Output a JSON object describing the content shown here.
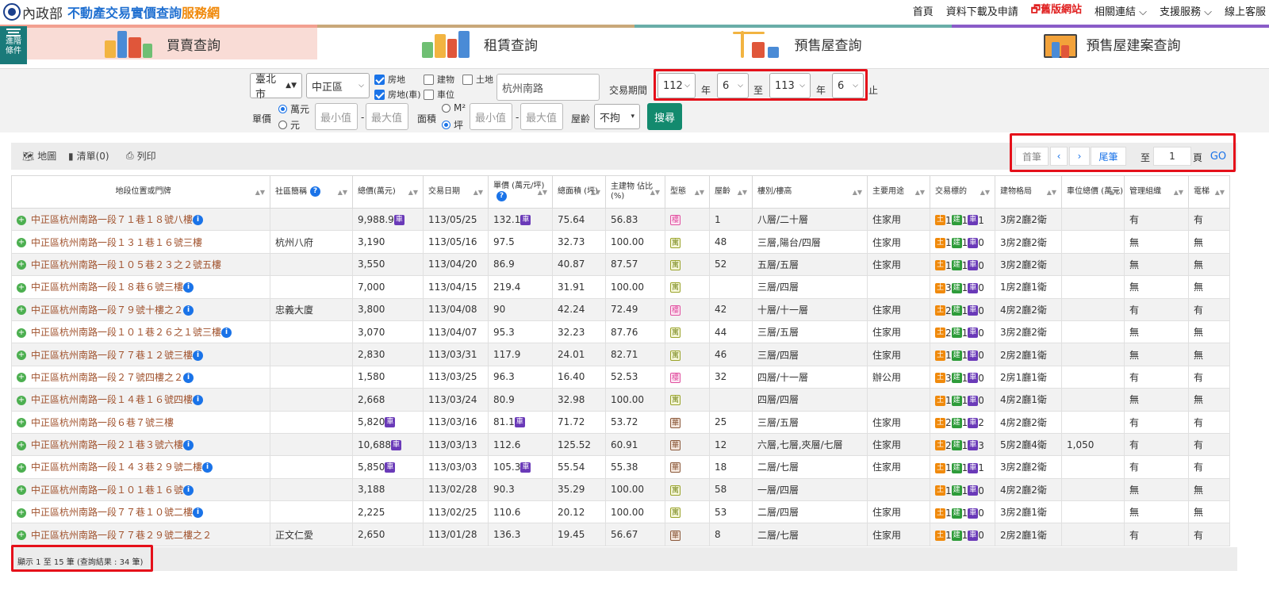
{
  "header": {
    "ministry": "內政部",
    "title_blue": "不動產交易實價查詢",
    "title_orange": "服務網",
    "nav": [
      {
        "label": "首頁"
      },
      {
        "label": "資料下載及申請"
      },
      {
        "label": "🗗舊版網站"
      },
      {
        "label": "相關連結 ⌵"
      },
      {
        "label": "支援服務 ⌵"
      },
      {
        "label": "線上客服"
      }
    ]
  },
  "advanced": {
    "label1": "進階",
    "label2": "條件"
  },
  "tabs": [
    {
      "label": "買賣查詢",
      "color": "#f2a090"
    },
    {
      "label": "租賃查詢",
      "color": "#c9a87a"
    },
    {
      "label": "預售屋查詢",
      "color": "#6aaea8"
    },
    {
      "label": "預售屋建案查詢",
      "color": "#8a5cc8"
    }
  ],
  "filters": {
    "city": "臺北市",
    "district": "中正區",
    "cb_land": "房地",
    "cb_land_car": "房地(車)",
    "cb_building": "建物",
    "cb_parking": "車位",
    "cb_soil": "土地",
    "road": "杭州南路",
    "period_label": "交易期間",
    "year_from": "112",
    "month_from": "6",
    "year_to": "113",
    "month_to": "6",
    "year_unit": "年",
    "to": "至",
    "end": "止",
    "price_label": "單價",
    "unit_wan": "萬元",
    "unit_yuan": "元",
    "min": "最小值",
    "max": "最大值",
    "dash": "-",
    "area_label": "面積",
    "unit_m2": "M²",
    "unit_ping": "坪",
    "age_label": "屋齡",
    "age_value": "不拘",
    "search": "搜尋"
  },
  "toolbar": {
    "map": "地圖",
    "list": "清單(0)",
    "print": "列印"
  },
  "pager": {
    "first": "首筆",
    "prev": "‹",
    "next": "›",
    "last": "尾筆",
    "to": "至",
    "page": "1",
    "page_unit": "頁",
    "go": "GO"
  },
  "table": {
    "headers": [
      "地段位置或門牌",
      "社區簡稱",
      "總價(萬元)",
      "交易日期",
      "單價 (萬元/坪)",
      "總面積 (坪)",
      "主建物 佔比(%)",
      "型態",
      "屋齡",
      "樓別/樓高",
      "主要用途",
      "交易標的",
      "建物格局",
      "車位總價 (萬元)",
      "管理組織",
      "電梯"
    ],
    "rows": [
      [
        "中正區杭州南路一段７１巷１８號八樓",
        "",
        "9,988.9",
        "113/05/25",
        "132.1",
        "75.64",
        "56.83",
        "樓",
        "1",
        "八層/二十層",
        "住家用",
        "1",
        "1",
        "1",
        "3房2廳2衛",
        "",
        "有",
        "有"
      ],
      [
        "中正區杭州南路一段１３１巷１６號三樓",
        "杭州八府",
        "3,190",
        "113/05/16",
        "97.5",
        "32.73",
        "100.00",
        "寓",
        "48",
        "三層,陽台/四層",
        "住家用",
        "1",
        "1",
        "0",
        "3房2廳2衛",
        "",
        "無",
        "無"
      ],
      [
        "中正區杭州南路一段１０５巷２３之２號五樓",
        "",
        "3,550",
        "113/04/20",
        "86.9",
        "40.87",
        "87.57",
        "寓",
        "52",
        "五層/五層",
        "住家用",
        "1",
        "1",
        "0",
        "3房2廳2衛",
        "",
        "無",
        "無"
      ],
      [
        "中正區杭州南路一段１８巷６號三樓",
        "",
        "7,000",
        "113/04/15",
        "219.4",
        "31.91",
        "100.00",
        "寓",
        "",
        "三層/四層",
        "",
        "3",
        "1",
        "0",
        "1房2廳1衛",
        "",
        "無",
        "無"
      ],
      [
        "中正區杭州南路一段７９號十樓之２",
        "忠義大廈",
        "3,800",
        "113/04/08",
        "90",
        "42.24",
        "72.49",
        "樓",
        "42",
        "十層/十一層",
        "住家用",
        "2",
        "1",
        "0",
        "4房2廳2衛",
        "",
        "有",
        "有"
      ],
      [
        "中正區杭州南路一段１０１巷２６之１號三樓",
        "",
        "3,070",
        "113/04/07",
        "95.3",
        "32.23",
        "87.76",
        "寓",
        "44",
        "三層/五層",
        "住家用",
        "2",
        "1",
        "0",
        "3房2廳2衛",
        "",
        "無",
        "無"
      ],
      [
        "中正區杭州南路一段７７巷１２號三樓",
        "",
        "2,830",
        "113/03/31",
        "117.9",
        "24.01",
        "82.71",
        "寓",
        "46",
        "三層/四層",
        "住家用",
        "1",
        "1",
        "0",
        "2房2廳1衛",
        "",
        "無",
        "無"
      ],
      [
        "中正區杭州南路一段２７號四樓之２",
        "",
        "1,580",
        "113/03/25",
        "96.3",
        "16.40",
        "52.53",
        "樓",
        "32",
        "四層/十一層",
        "辦公用",
        "3",
        "1",
        "0",
        "2房1廳1衛",
        "",
        "有",
        "有"
      ],
      [
        "中正區杭州南路一段１４巷１６號四樓",
        "",
        "2,668",
        "113/03/24",
        "80.9",
        "32.98",
        "100.00",
        "寓",
        "",
        "四層/四層",
        "",
        "1",
        "1",
        "0",
        "4房2廳1衛",
        "",
        "無",
        "無"
      ],
      [
        "中正區杭州南路一段６巷７號三樓",
        "",
        "5,820",
        "113/03/16",
        "81.1",
        "71.72",
        "53.72",
        "華",
        "25",
        "三層/五層",
        "住家用",
        "2",
        "1",
        "2",
        "4房2廳2衛",
        "",
        "有",
        "有"
      ],
      [
        "中正區杭州南路一段２１巷３號六樓",
        "",
        "10,688",
        "113/03/13",
        "112.6",
        "125.52",
        "60.91",
        "華",
        "12",
        "六層,七層,夾層/七層",
        "住家用",
        "2",
        "1",
        "3",
        "5房2廳4衛",
        "1,050",
        "有",
        "有"
      ],
      [
        "中正區杭州南路一段１４３巷２９號二樓",
        "",
        "5,850",
        "113/03/03",
        "105.3",
        "55.54",
        "55.38",
        "華",
        "18",
        "二層/七層",
        "住家用",
        "1",
        "1",
        "1",
        "3房2廳2衛",
        "",
        "有",
        "有"
      ],
      [
        "中正區杭州南路一段１０１巷１６號",
        "",
        "3,188",
        "113/02/28",
        "90.3",
        "35.29",
        "100.00",
        "寓",
        "58",
        "一層/四層",
        "",
        "1",
        "1",
        "0",
        "4房2廳2衛",
        "",
        "無",
        "無"
      ],
      [
        "中正區杭州南路一段７７巷１０號二樓",
        "",
        "2,225",
        "113/02/25",
        "110.6",
        "20.12",
        "100.00",
        "寓",
        "53",
        "二層/四層",
        "住家用",
        "1",
        "1",
        "0",
        "3房2廳1衛",
        "",
        "無",
        "無"
      ],
      [
        "中正區杭州南路一段７７巷２９號二樓之２",
        "正文仁愛",
        "2,650",
        "113/01/28",
        "136.3",
        "19.45",
        "56.67",
        "華",
        "8",
        "二層/七層",
        "住家用",
        "1",
        "1",
        "0",
        "2房2廳1衛",
        "",
        "有",
        "有"
      ]
    ],
    "info_rows": [
      0,
      3,
      4,
      5,
      6,
      7,
      8,
      10,
      11,
      12,
      13
    ],
    "car_rows": [
      0,
      9,
      10,
      11
    ],
    "car_price_rows": [
      0,
      9,
      11
    ],
    "tag_car": "車",
    "tag_land": "土",
    "tag_build": "建",
    "tag_park": "車"
  },
  "footer": "顯示 1 至 15 筆 (查詢結果 : 34 筆)"
}
